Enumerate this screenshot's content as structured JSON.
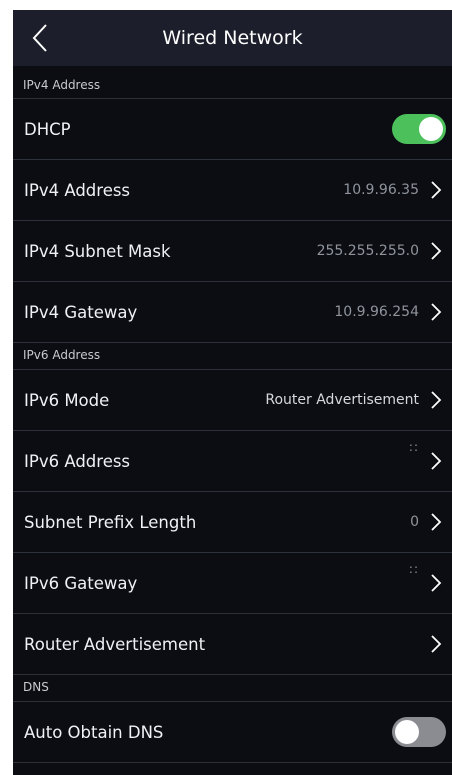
{
  "header": {
    "title": "Wired Network"
  },
  "sections": {
    "ipv4": "IPv4 Address",
    "ipv6": "IPv6 Address",
    "dns": "DNS"
  },
  "rows": {
    "dhcp": {
      "label": "DHCP",
      "enabled": true
    },
    "ipv4_address": {
      "label": "IPv4 Address",
      "value": "10.9.96.35"
    },
    "ipv4_subnet_mask": {
      "label": "IPv4 Subnet Mask",
      "value": "255.255.255.0"
    },
    "ipv4_gateway": {
      "label": "IPv4 Gateway",
      "value": "10.9.96.254"
    },
    "ipv6_mode": {
      "label": "IPv6 Mode",
      "value": "Router Advertisement"
    },
    "ipv6_address": {
      "label": "IPv6 Address",
      "value": "::"
    },
    "subnet_prefix_length": {
      "label": "Subnet Prefix Length",
      "value": "0"
    },
    "ipv6_gateway": {
      "label": "IPv6 Gateway",
      "value": "::"
    },
    "router_advertisement": {
      "label": "Router Advertisement"
    },
    "auto_obtain_dns": {
      "label": "Auto Obtain DNS",
      "enabled": false
    }
  },
  "colors": {
    "background": "#0b0d12",
    "header": "#1c1f2b",
    "toggle_on": "#4cc05a",
    "toggle_off": "#8a8c92"
  }
}
